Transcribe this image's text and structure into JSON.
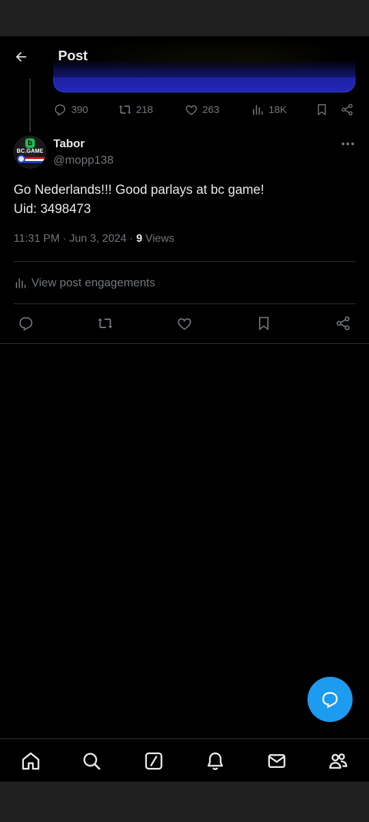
{
  "header": {
    "title": "Post"
  },
  "parent_post": {
    "actions": {
      "replies": "390",
      "reposts": "218",
      "likes": "263",
      "views": "18K"
    }
  },
  "post": {
    "author": {
      "display_name": "Tabor",
      "handle": "@mopp138",
      "avatar_text": "BC.GAME",
      "avatar_letter": "b"
    },
    "text_lines": [
      "Go Nederlands!!! Good parlays at bc game!",
      "Uid: 3498473"
    ],
    "timestamp": "11:31 PM · Jun 3, 2024 · ",
    "views_count": "9",
    "views_label": " Views",
    "engagements_label": "View post engagements"
  },
  "colors": {
    "background": "#000000",
    "text_primary": "#e7e9ea",
    "text_secondary": "#71767b",
    "divider": "#2f3336",
    "accent": "#1d9bf0"
  },
  "icons": {
    "header": [
      "back-arrow-icon"
    ],
    "post_actions": [
      "reply-icon",
      "repost-icon",
      "like-icon",
      "bookmark-icon",
      "share-icon"
    ],
    "bottom_nav": [
      "home-icon",
      "search-icon",
      "grok-icon",
      "notifications-icon",
      "messages-icon",
      "communities-icon"
    ],
    "fab": "compose-reply-icon"
  }
}
